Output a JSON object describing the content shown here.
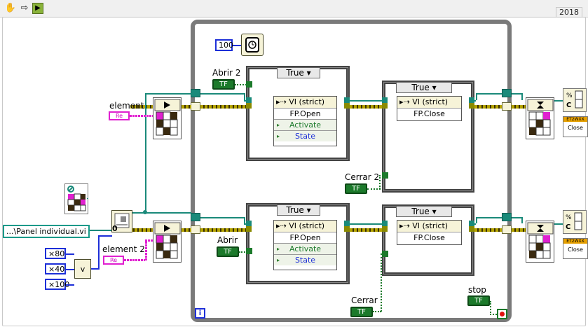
{
  "window": {
    "year_badge": "2018"
  },
  "toolbar": {
    "icons": [
      "grab-hand-icon",
      "run-arrow-icon",
      "run-continuously-icon"
    ],
    "glyph_hand": "✋",
    "glyph_arrow": "⇨",
    "glyph_run": "▶"
  },
  "loop": {
    "wait_ms": "100",
    "iteration_terminal": "i",
    "stop_label": "stop",
    "bool_glyph": "TF"
  },
  "inputs": {
    "element_label": "element",
    "element2_label": "element 2",
    "path_value": "...\\Panel individual.vi",
    "n80": "80",
    "n40": "40",
    "n100": "100",
    "mult_glyph": "×",
    "ref_glyph": "Re"
  },
  "top_branch": {
    "abrir_label": "Abrir 2",
    "cerrar_label": "Cerrar 2",
    "case_selector_open": "True",
    "case_selector_close": "True",
    "vi_strict": "VI (strict)",
    "method_open": "FP.Open",
    "prop_activate": "Activate",
    "prop_state": "State",
    "method_close": "FP.Close"
  },
  "bottom_branch": {
    "abrir_label": "Abrir",
    "cerrar_label": "Cerrar",
    "case_selector_open": "True",
    "case_selector_close": "True",
    "vi_strict": "VI (strict)",
    "method_open": "FP.Open",
    "prop_activate": "Activate",
    "prop_state": "State",
    "method_close": "FP.Close"
  },
  "close_ref": {
    "label": "Close",
    "badge": "ET2WXX"
  },
  "colors": {
    "bool_green": "#1c7a2b",
    "refnum_yellow": "#b3a200",
    "path_teal": "#1a8a7a",
    "numeric_blue": "#1d2fd8",
    "cluster_pink": "#e020d0"
  }
}
